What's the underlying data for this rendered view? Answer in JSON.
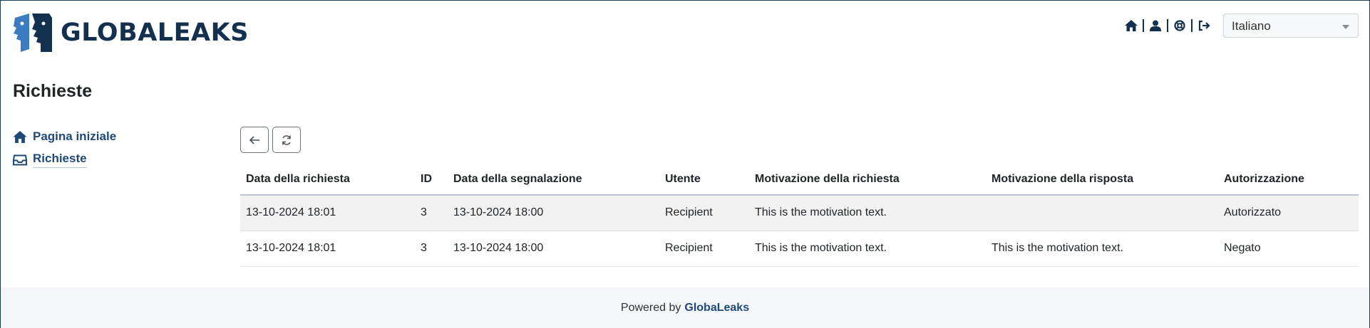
{
  "brand": {
    "name": "GLOBALEAKS"
  },
  "header": {
    "icons": [
      "home-icon",
      "user-icon",
      "support-icon",
      "logout-icon"
    ],
    "language": "Italiano"
  },
  "page": {
    "title": "Richieste"
  },
  "sidebar": {
    "items": [
      {
        "label": "Pagina iniziale",
        "icon": "home-icon"
      },
      {
        "label": "Richieste",
        "icon": "inbox-icon"
      }
    ]
  },
  "toolbar": {
    "back_icon": "arrow-left-icon",
    "refresh_icon": "refresh-icon"
  },
  "table": {
    "headers": [
      "Data della richiesta",
      "ID",
      "Data della segnalazione",
      "Utente",
      "Motivazione della richiesta",
      "Motivazione della risposta",
      "Autorizzazione"
    ],
    "rows": [
      [
        "13-10-2024 18:01",
        "3",
        "13-10-2024 18:00",
        "Recipient",
        "This is the motivation text.",
        "",
        "Autorizzato"
      ],
      [
        "13-10-2024 18:01",
        "3",
        "13-10-2024 18:00",
        "Recipient",
        "This is the motivation text.",
        "This is the motivation text.",
        "Negato"
      ]
    ]
  },
  "footer": {
    "prefix": "Powered by",
    "link": "GlobaLeaks"
  },
  "colors": {
    "brand_dark": "#14304f",
    "brand_light": "#3b7bc0",
    "link": "#1f4a77"
  }
}
